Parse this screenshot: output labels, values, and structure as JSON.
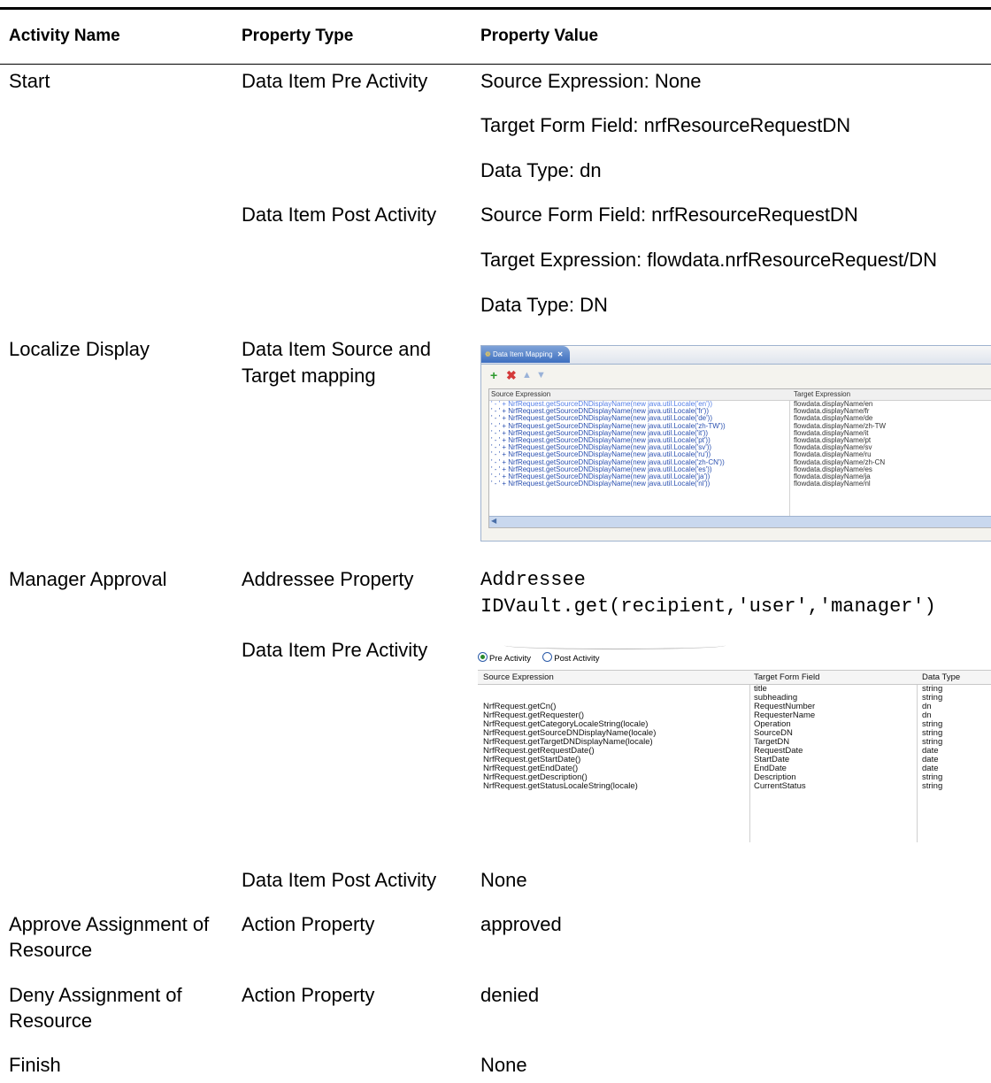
{
  "headers": {
    "activity_name": "Activity Name",
    "property_type": "Property Type",
    "property_value": "Property Value"
  },
  "rows": {
    "start": {
      "activity": "Start",
      "pre_type": "Data Item Pre Activity",
      "pre_values": [
        "Source Expression: None",
        "Target Form Field: nrfResourceRequestDN",
        "Data Type: dn"
      ],
      "post_type": "Data Item Post Activity",
      "post_values": [
        "Source Form Field: nrfResourceRequestDN",
        "Target Expression: flowdata.nrfResourceRequest/DN",
        "Data Type: DN"
      ]
    },
    "localize": {
      "activity": "Localize Display",
      "type_line1": "Data Item Source and",
      "type_line2": "Target mapping"
    },
    "manager": {
      "activity": "Manager Approval",
      "addressee_type": "Addressee Property",
      "addressee_line1": "Addressee",
      "addressee_line2": "IDVault.get(recipient,'user','manager')",
      "pre_type": "Data Item Pre Activity",
      "post_type": "Data Item Post Activity",
      "post_value": "None"
    },
    "approve": {
      "activity_line1": "Approve Assignment of",
      "activity_line2": "Resource",
      "type": "Action Property",
      "value": "approved"
    },
    "deny": {
      "activity_line1": "Deny Assignment of",
      "activity_line2": "Resource",
      "type": "Action Property",
      "value": "denied"
    },
    "finish": {
      "activity": "Finish",
      "value": "None"
    }
  },
  "mapping_screenshot": {
    "tab_label": "Data Item Mapping",
    "col_source": "Source Expression",
    "col_target": "Target Expression",
    "rows": [
      {
        "src": "' - ' + NrfRequest.getSourceDNDisplayName(new java.util.Locale('en'))",
        "tgt": "flowdata.displayName/en"
      },
      {
        "src": "' - ' + NrfRequest.getSourceDNDisplayName(new java.util.Locale('fr'))",
        "tgt": "flowdata.displayName/fr"
      },
      {
        "src": "' - ' + NrfRequest.getSourceDNDisplayName(new java.util.Locale('de'))",
        "tgt": "flowdata.displayName/de"
      },
      {
        "src": "' - ' + NrfRequest.getSourceDNDisplayName(new java.util.Locale('zh-TW'))",
        "tgt": "flowdata.displayName/zh-TW"
      },
      {
        "src": "' - ' + NrfRequest.getSourceDNDisplayName(new java.util.Locale('it'))",
        "tgt": "flowdata.displayName/it"
      },
      {
        "src": "' - ' + NrfRequest.getSourceDNDisplayName(new java.util.Locale('pt'))",
        "tgt": "flowdata.displayName/pt"
      },
      {
        "src": "' - ' + NrfRequest.getSourceDNDisplayName(new java.util.Locale('sv'))",
        "tgt": "flowdata.displayName/sv"
      },
      {
        "src": "' - ' + NrfRequest.getSourceDNDisplayName(new java.util.Locale('ru'))",
        "tgt": "flowdata.displayName/ru"
      },
      {
        "src": "' - ' + NrfRequest.getSourceDNDisplayName(new java.util.Locale('zh-CN'))",
        "tgt": "flowdata.displayName/zh-CN"
      },
      {
        "src": "' - ' + NrfRequest.getSourceDNDisplayName(new java.util.Locale('es'))",
        "tgt": "flowdata.displayName/es"
      },
      {
        "src": "' - ' + NrfRequest.getSourceDNDisplayName(new java.util.Locale('ja'))",
        "tgt": "flowdata.displayName/ja"
      },
      {
        "src": "' - ' + NrfRequest.getSourceDNDisplayName(new java.util.Locale('nl'))",
        "tgt": "flowdata.displayName/nl"
      }
    ]
  },
  "pre_activity_screenshot": {
    "radio_pre": "Pre Activity",
    "radio_post": "Post Activity",
    "col_source": "Source Expression",
    "col_target": "Target Form Field",
    "col_type": "Data Type",
    "rows": [
      {
        "src": "",
        "tgt": "title",
        "type": "string"
      },
      {
        "src": "",
        "tgt": "subheading",
        "type": "string"
      },
      {
        "src": "NrfRequest.getCn()",
        "tgt": "RequestNumber",
        "type": "dn"
      },
      {
        "src": "NrfRequest.getRequester()",
        "tgt": "RequesterName",
        "type": "dn"
      },
      {
        "src": "NrfRequest.getCategoryLocaleString(locale)",
        "tgt": "Operation",
        "type": "string"
      },
      {
        "src": "NrfRequest.getSourceDNDisplayName(locale)",
        "tgt": "SourceDN",
        "type": "string"
      },
      {
        "src": "NrfRequest.getTargetDNDisplayName(locale)",
        "tgt": "TargetDN",
        "type": "string"
      },
      {
        "src": "NrfRequest.getRequestDate()",
        "tgt": "RequestDate",
        "type": "date"
      },
      {
        "src": "NrfRequest.getStartDate()",
        "tgt": "StartDate",
        "type": "date"
      },
      {
        "src": "NrfRequest.getEndDate()",
        "tgt": "EndDate",
        "type": "date"
      },
      {
        "src": "NrfRequest.getDescription()",
        "tgt": "Description",
        "type": "string"
      },
      {
        "src": "NrfRequest.getStatusLocaleString(locale)",
        "tgt": "CurrentStatus",
        "type": "string"
      }
    ]
  }
}
